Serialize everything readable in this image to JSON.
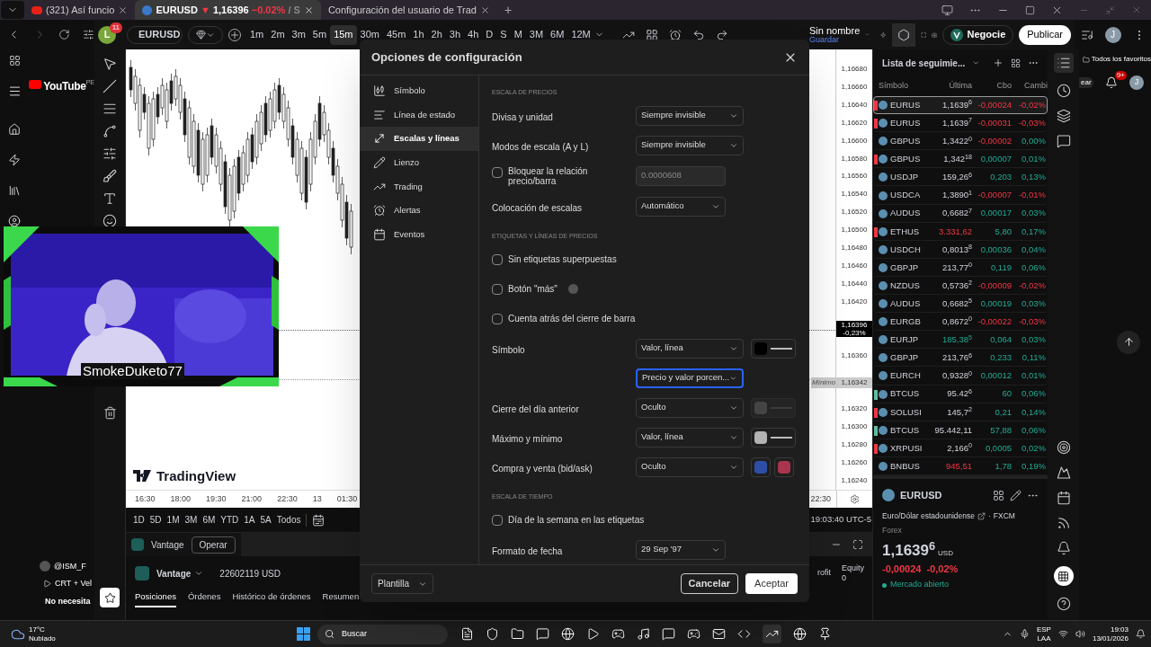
{
  "browser": {
    "tabs": [
      {
        "kind": "video",
        "label": "(321) Así funcio",
        "selected": false
      },
      {
        "kind": "symbol",
        "label": "EURUSD",
        "arrow": "▼",
        "price": "1,16396",
        "change": "−0.02%",
        "suffix": "/ S",
        "selected": true
      },
      {
        "kind": "page",
        "label": "Configuración del usuario de Trad",
        "selected": false
      }
    ],
    "new_tab": "+"
  },
  "toolbar": {
    "avatar": "L",
    "badge": "11",
    "search": "EURUSD",
    "intervals": [
      {
        "label": "1m",
        "selected": false
      },
      {
        "label": "2m",
        "selected": false
      },
      {
        "label": "3m",
        "selected": false
      },
      {
        "label": "5m",
        "selected": false
      },
      {
        "label": "15m",
        "selected": true
      },
      {
        "label": "30m",
        "selected": false
      },
      {
        "label": "45m",
        "selected": false
      },
      {
        "label": "1h",
        "selected": false
      },
      {
        "label": "2h",
        "selected": false
      },
      {
        "label": "3h",
        "selected": false
      },
      {
        "label": "4h",
        "selected": false
      },
      {
        "label": "D",
        "selected": false
      },
      {
        "label": "S",
        "selected": false
      },
      {
        "label": "M",
        "selected": false
      },
      {
        "label": "3M",
        "selected": false
      },
      {
        "label": "6M",
        "selected": false
      },
      {
        "label": "12M",
        "selected": false
      }
    ],
    "avatar_right": "J",
    "layout_name": "Sin nombre",
    "save": "Guardar",
    "trade_button": "Negocie",
    "publish_button": "Publicar"
  },
  "youtube": {
    "logo": "YouTube",
    "region": "PE",
    "channel": "@ISM_F",
    "video": "CRT + Vel",
    "note": "No necesita"
  },
  "webcam": {
    "name": "SmokeDuketo77"
  },
  "chart": {
    "brand": "TradingView",
    "price_axis": [
      {
        "kind": "tick",
        "label": "1,16680"
      },
      {
        "kind": "tick",
        "label": "1,16660"
      },
      {
        "kind": "tick",
        "label": "1,16640"
      },
      {
        "kind": "tick",
        "label": "1,16620"
      },
      {
        "kind": "tick",
        "label": "1,16600"
      },
      {
        "kind": "tick",
        "label": "1,16580"
      },
      {
        "kind": "tick",
        "label": "1,16560"
      },
      {
        "kind": "tick",
        "label": "1,16540"
      },
      {
        "kind": "tick",
        "label": "1,16520"
      },
      {
        "kind": "tick",
        "label": "1,16500"
      },
      {
        "kind": "tick",
        "label": "1,16480"
      },
      {
        "kind": "tick",
        "label": "1,16460"
      },
      {
        "kind": "tick",
        "label": "1,16440"
      },
      {
        "kind": "tick",
        "label": "1,16420"
      },
      {
        "kind": "last",
        "label": "1,16396",
        "sub": "-0,23%"
      },
      {
        "kind": "tick",
        "label": "1,16360"
      },
      {
        "kind": "low",
        "label": "1,16342",
        "tag": "Mínimo"
      },
      {
        "kind": "tick",
        "label": "1,16320"
      },
      {
        "kind": "tick",
        "label": "1,16300"
      },
      {
        "kind": "tick",
        "label": "1,16280"
      },
      {
        "kind": "tick",
        "label": "1,16260"
      },
      {
        "kind": "tick",
        "label": "1,16240"
      }
    ],
    "time_axis": [
      "16:30",
      "18:00",
      "19:30",
      "21:00",
      "22:30",
      "13",
      "01:30"
    ],
    "time_axis_right": "22:30",
    "ranges": [
      "1D",
      "5D",
      "1M",
      "3M",
      "6M",
      "YTD",
      "1A",
      "5A",
      "Todos"
    ],
    "clock": "19:03:40 UTC-5"
  },
  "trading_panel": {
    "broker_tab": "Vantage",
    "operate_button": "Operar",
    "account": "Vantage",
    "account_id": "22602119 USD",
    "tabs": [
      {
        "label": "Posiciones",
        "selected": true
      },
      {
        "label": "Órdenes",
        "selected": false
      },
      {
        "label": "Histórico de órdenes",
        "selected": false
      },
      {
        "label": "Resumen",
        "selected": false
      }
    ],
    "column_profit": "rofit",
    "column_equity": "Equity",
    "equity_value": "0"
  },
  "dialog": {
    "title": "Opciones de configuración",
    "nav": [
      {
        "label": "Símbolo",
        "selected": false
      },
      {
        "label": "Línea de estado",
        "selected": false
      },
      {
        "label": "Escalas y líneas",
        "selected": true
      },
      {
        "label": "Lienzo",
        "selected": false
      },
      {
        "label": "Trading",
        "selected": false
      },
      {
        "label": "Alertas",
        "selected": false
      },
      {
        "label": "Eventos",
        "selected": false
      }
    ],
    "items": [
      {
        "kind": "section",
        "label": "ESCALA DE PRECIOS"
      },
      {
        "kind": "select",
        "label": "Divisa y unidad",
        "value": "Siempre invisible",
        "focused": false
      },
      {
        "kind": "select",
        "label": "Modos de escala (A y L)",
        "value": "Siempre invisible",
        "focused": false
      },
      {
        "kind": "checkbox_input",
        "label": "Bloquear la relación precio/barra",
        "checked": false,
        "value": "0.0000608",
        "disabled": true
      },
      {
        "kind": "short_select",
        "label": "Colocación de escalas",
        "value": "Automático",
        "focused": false
      },
      {
        "kind": "section",
        "label": "ETIQUETAS Y LÍNEAS DE PRECIOS"
      },
      {
        "kind": "checkbox",
        "label": "Sin etiquetas superpuestas",
        "checked": false,
        "help": false
      },
      {
        "kind": "checkbox",
        "label": "Botón \"más\"",
        "checked": false,
        "help": true
      },
      {
        "kind": "checkbox",
        "label": "Cuenta atrás del cierre de barra",
        "checked": false,
        "help": false
      },
      {
        "kind": "select",
        "label": "Símbolo",
        "value": "Valor, línea",
        "focused": false,
        "swatches": [
          {
            "color": "#000000",
            "line": true,
            "disabled": false
          }
        ]
      },
      {
        "kind": "select",
        "value": "Precio y valor porcen...",
        "focused": true
      },
      {
        "kind": "select",
        "label": "Cierre del día anterior",
        "value": "Oculto",
        "focused": false,
        "swatches": [
          {
            "color": "#444444",
            "line": true,
            "disabled": true
          }
        ]
      },
      {
        "kind": "select",
        "label": "Máximo y mínimo",
        "value": "Valor, línea",
        "focused": false,
        "swatches": [
          {
            "color": "#b2b2b2",
            "line": true,
            "disabled": false
          }
        ]
      },
      {
        "kind": "select",
        "label": "Compra y venta (bid/ask)",
        "value": "Oculto",
        "focused": false,
        "swatches": [
          {
            "color": "#2e4ea6",
            "line": false,
            "disabled": false
          },
          {
            "color": "#a8364c",
            "line": false,
            "disabled": false
          }
        ]
      },
      {
        "kind": "section",
        "label": "ESCALA DE TIEMPO"
      },
      {
        "kind": "checkbox",
        "label": "Día de la semana en las etiquetas",
        "checked": false,
        "help": false
      },
      {
        "kind": "short_select",
        "label": "Formato de fecha",
        "value": "29 Sep '97",
        "focused": false
      }
    ],
    "template": "Plantilla",
    "cancel": "Cancelar",
    "accept": "Aceptar"
  },
  "watchlist": {
    "title": "Lista de seguimie...",
    "columns": [
      "Símbolo",
      "Última",
      "Cbo",
      "Cambi"
    ],
    "rows": [
      {
        "symbol": "EURUS",
        "last": "1,1639$^{6}$",
        "last_falling": false,
        "last_rising": false,
        "change": "-0,00024",
        "pct": "-0,02%",
        "falling": true,
        "pct_falling": true,
        "color": "#f23645",
        "selected": true
      },
      {
        "symbol": "EURUS",
        "last": "1,1639$^{7}$",
        "last_falling": false,
        "last_rising": false,
        "change": "-0,00031",
        "pct": "-0,03%",
        "falling": true,
        "pct_falling": true,
        "color": "#f23645",
        "selected": false
      },
      {
        "symbol": "GBPUS",
        "last": "1,3422$^{0}$",
        "last_falling": false,
        "last_rising": false,
        "change": "-0,00002",
        "pct": "0,00%",
        "falling": true,
        "pct_falling": false,
        "selected": false
      },
      {
        "symbol": "GBPUS",
        "last": "1,342$^{18}$",
        "last_falling": false,
        "last_rising": false,
        "change": "0,00007",
        "pct": "0,01%",
        "falling": false,
        "pct_falling": false,
        "color": "#f23645",
        "selected": false
      },
      {
        "symbol": "USDJP",
        "last": "159,26$^{6}$",
        "last_falling": false,
        "last_rising": false,
        "change": "0,203",
        "pct": "0,13%",
        "falling": false,
        "pct_falling": false,
        "selected": false
      },
      {
        "symbol": "USDCA",
        "last": "1,3890$^{1}$",
        "last_falling": false,
        "last_rising": false,
        "change": "-0,00007",
        "pct": "-0,01%",
        "falling": true,
        "pct_falling": true,
        "selected": false
      },
      {
        "symbol": "AUDUS",
        "last": "0,6682$^{7}$",
        "last_falling": false,
        "last_rising": false,
        "change": "0,00017",
        "pct": "0,03%",
        "falling": false,
        "pct_falling": false,
        "selected": false
      },
      {
        "symbol": "ETHUS",
        "last": "3.331,62",
        "last_falling": true,
        "last_rising": false,
        "change": "5,80",
        "pct": "0,17%",
        "falling": false,
        "pct_falling": false,
        "color": "#f23645",
        "selected": false
      },
      {
        "symbol": "USDCH",
        "last": "0,8013$^{8}$",
        "last_falling": false,
        "last_rising": false,
        "change": "0,00036",
        "pct": "0,04%",
        "falling": false,
        "pct_falling": false,
        "selected": false
      },
      {
        "symbol": "GBPJP",
        "last": "213,77$^{0}$",
        "last_falling": false,
        "last_rising": false,
        "change": "0,119",
        "pct": "0,06%",
        "falling": false,
        "pct_falling": false,
        "selected": false
      },
      {
        "symbol": "NZDUS",
        "last": "0,5736$^{2}$",
        "last_falling": false,
        "last_rising": false,
        "change": "-0,00009",
        "pct": "-0,02%",
        "falling": true,
        "pct_falling": true,
        "selected": false
      },
      {
        "symbol": "AUDUS",
        "last": "0,6682$^{5}$",
        "last_falling": false,
        "last_rising": false,
        "change": "0,00019",
        "pct": "0,03%",
        "falling": false,
        "pct_falling": false,
        "selected": false
      },
      {
        "symbol": "EURGB",
        "last": "0,8672$^{0}$",
        "last_falling": false,
        "last_rising": false,
        "change": "-0,00022",
        "pct": "-0,03%",
        "falling": true,
        "pct_falling": true,
        "selected": false
      },
      {
        "symbol": "EURJP",
        "last": "185,38$^{5}$",
        "last_falling": false,
        "last_rising": true,
        "change": "0,064",
        "pct": "0,03%",
        "falling": false,
        "pct_falling": false,
        "selected": false
      },
      {
        "symbol": "GBPJP",
        "last": "213,76$^{6}$",
        "last_falling": false,
        "last_rising": false,
        "change": "0,233",
        "pct": "0,11%",
        "falling": false,
        "pct_falling": false,
        "selected": false
      },
      {
        "symbol": "EURCH",
        "last": "0,9328$^{0}$",
        "last_falling": false,
        "last_rising": false,
        "change": "0,00012",
        "pct": "0,01%",
        "falling": false,
        "pct_falling": false,
        "selected": false
      },
      {
        "symbol": "BTCUS",
        "last": "95.42$^{6}$",
        "last_falling": false,
        "last_rising": false,
        "change": "60",
        "pct": "0,06%",
        "falling": false,
        "pct_falling": false,
        "color": "#5fbf9f",
        "selected": false
      },
      {
        "symbol": "SOLUSI",
        "last": "145,7$^{2}$",
        "last_falling": false,
        "last_rising": false,
        "change": "0,21",
        "pct": "0,14%",
        "falling": false,
        "pct_falling": false,
        "color": "#f23645",
        "selected": false
      },
      {
        "symbol": "BTCUS",
        "last": "95.442,11",
        "last_falling": false,
        "last_rising": false,
        "change": "57,88",
        "pct": "0,06%",
        "falling": false,
        "pct_falling": false,
        "color": "#5fbf9f",
        "selected": false
      },
      {
        "symbol": "XRPUSI",
        "last": "2,166$^{0}$",
        "last_falling": false,
        "last_rising": false,
        "change": "0,0005",
        "pct": "0,02%",
        "falling": false,
        "pct_falling": false,
        "color": "#f23645",
        "selected": false
      },
      {
        "symbol": "BNBUS",
        "last": "945,51",
        "last_falling": true,
        "last_rising": false,
        "change": "1,78",
        "pct": "0,19%",
        "falling": false,
        "pct_falling": false,
        "selected": false
      }
    ]
  },
  "symbol_details": {
    "symbol": "EURUSD",
    "description": "Euro/Dólar estadounidense",
    "separator": "·",
    "exchange": "FXCM",
    "type": "Forex",
    "price": "1,1639$^{6}$",
    "currency": "USD",
    "change": "-0,00024",
    "pct": "-0,02%",
    "falling": true,
    "status": "Mercado abierto"
  },
  "side": {
    "favorites": "Todos los favoritos",
    "create": "ear",
    "notifications": "9+",
    "avatar": "J"
  },
  "taskbar": {
    "temperature": "17°C",
    "weather": "Nublado",
    "search": "Buscar",
    "language": "ESP",
    "layout": "LAA",
    "time": "19:03",
    "date": "13/01/2026"
  }
}
